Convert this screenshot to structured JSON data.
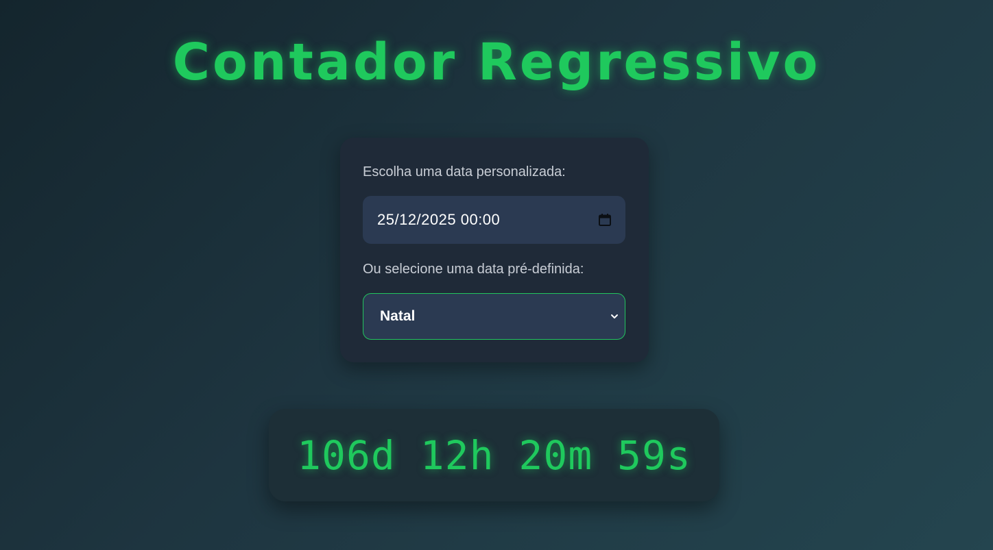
{
  "header": {
    "title": "Contador Regressivo"
  },
  "form": {
    "custom_label": "Escolha uma data personalizada:",
    "custom_date_value": "25/12/2025 00:00",
    "preset_label": "Ou selecione uma data pré-definida:",
    "preset_selected": "Natal",
    "calendar_icon": "calendar-icon",
    "dropdown_icon": "chevron-down-icon"
  },
  "countdown": {
    "display": "106d 12h 20m 59s",
    "days": 106,
    "hours": 12,
    "minutes": 20,
    "seconds": 59
  },
  "colors": {
    "accent": "#1fc95d",
    "card_background": "#1f2a38",
    "input_background": "#2b3a52",
    "focus_border": "#22c55e"
  }
}
